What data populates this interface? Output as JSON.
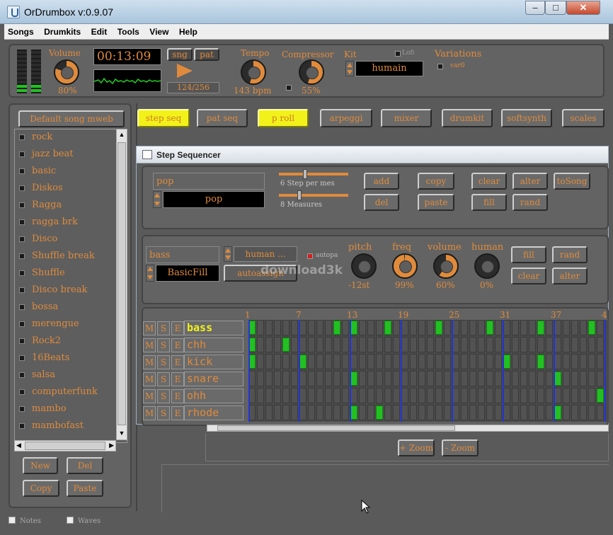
{
  "window": {
    "title": "OrDrumbox v:0.9.07"
  },
  "menu": [
    "Songs",
    "Drumkits",
    "Edit",
    "Tools",
    "View",
    "Help"
  ],
  "transport": {
    "volume_label": "Volume",
    "volume_value": "80%",
    "volume_level": 0.8,
    "time": "00:13:09",
    "mode_song": "sng",
    "mode_pattern": "pat",
    "position": "124/256",
    "tempo_label": "Tempo",
    "tempo_value": "143 bpm",
    "tempo_level": 0.55,
    "compressor_label": "Compressor",
    "compressor_value": "55%",
    "compressor_level": 0.55,
    "kit_label": "Kit",
    "kit_value": "humain",
    "lofi_label": "Lofi",
    "variations_label": "Variations",
    "variation_item": "var0"
  },
  "song_panel": {
    "title": "Default song mweb",
    "songs": [
      "rock",
      "jazz beat",
      "basic",
      "Diskos",
      "Ragga",
      "ragga brk",
      "Disco",
      "Shuffle break",
      "Shuffle",
      "Disco break",
      "bossa",
      "merengue",
      "Rock2",
      "16Beats",
      "salsa",
      "computerfunk",
      "mambo",
      "mambofast"
    ],
    "new_label": "New",
    "del_label": "Del",
    "copy_label": "Copy",
    "paste_label": "Paste"
  },
  "tabs": [
    {
      "label": "step seq",
      "active": true
    },
    {
      "label": "pat seq",
      "active": false
    },
    {
      "label": "p roll",
      "active": true
    },
    {
      "label": "arpeggi",
      "active": false
    },
    {
      "label": "mixer",
      "active": false
    },
    {
      "label": "drumkit",
      "active": false
    },
    {
      "label": "softsynth",
      "active": false
    },
    {
      "label": "scales",
      "active": false
    }
  ],
  "step_sequencer": {
    "title": "Step Sequencer",
    "pattern_name": "pop",
    "pattern_value": "pop",
    "steps_label": "6 Step per mes",
    "measures_label": "8 Measures",
    "buttons": {
      "add": "add",
      "copy": "copy",
      "clear": "clear",
      "alter": "alter",
      "tosong": "toSong",
      "del": "del",
      "paste": "paste",
      "fill": "fill",
      "rand": "rand"
    },
    "track_name": "bass",
    "track_value": "BasicFill",
    "instrument": "human ...",
    "autoassign": "autoassign",
    "autopa_label": "autopa",
    "pitch_label": "pitch",
    "pitch_value": "-12st",
    "pitch_level": 0.5,
    "freq_label": "freq",
    "freq_value": "99%",
    "freq_level": 0.99,
    "volume_label": "volume",
    "volume_value": "60%",
    "volume_level": 0.6,
    "human_label": "human",
    "human_value": "0%",
    "human_level": 0,
    "track_buttons": {
      "fill": "fill",
      "rand": "rand",
      "clear": "clear",
      "alter": "alter"
    },
    "ruler": [
      "1",
      "7",
      "13",
      "19",
      "25",
      "31",
      "37",
      "4"
    ],
    "mse": {
      "m": "M",
      "s": "S",
      "e": "E"
    },
    "tracks": [
      {
        "name": "bass",
        "selected": true,
        "notes": [
          0,
          10,
          12,
          16,
          22,
          28,
          34,
          40
        ]
      },
      {
        "name": "chh",
        "selected": false,
        "notes": [
          0,
          4
        ]
      },
      {
        "name": "kick",
        "selected": false,
        "notes": [
          0,
          6,
          30,
          34
        ]
      },
      {
        "name": "snare",
        "selected": false,
        "notes": [
          12,
          36
        ]
      },
      {
        "name": "ohh",
        "selected": false,
        "notes": [
          41
        ]
      },
      {
        "name": "rhode",
        "selected": false,
        "notes": [
          12,
          15,
          36
        ]
      }
    ],
    "zoom_in": "+ Zoom",
    "zoom_out": "- Zoom"
  },
  "status": {
    "notes_label": "Notes",
    "waves_label": "Waves"
  },
  "watermark": "download3k"
}
